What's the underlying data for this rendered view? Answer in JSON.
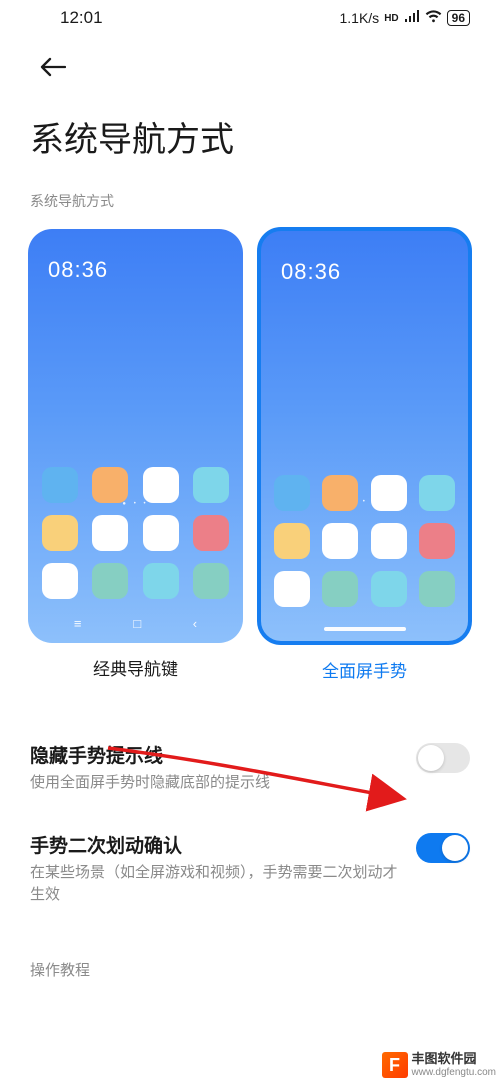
{
  "status": {
    "time": "12:01",
    "speed": "1.1K/s",
    "hd": "HD",
    "battery": "96"
  },
  "page": {
    "title": "系统导航方式",
    "section_label": "系统导航方式"
  },
  "options": {
    "preview_time": "08:36",
    "legacy_label": "经典导航键",
    "gesture_label": "全面屏手势",
    "selected": "gesture"
  },
  "settings": {
    "hide_hint": {
      "title": "隐藏手势提示线",
      "desc": "使用全面屏手势时隐藏底部的提示线",
      "value": false
    },
    "double_swipe": {
      "title": "手势二次划动确认",
      "desc": "在某些场景（如全屏游戏和视频），手势需要二次划动才生效",
      "value": true
    }
  },
  "tutorial": {
    "label": "操作教程"
  },
  "watermark": {
    "name": "丰图软件园",
    "url": "www.dgfengtu.com"
  }
}
